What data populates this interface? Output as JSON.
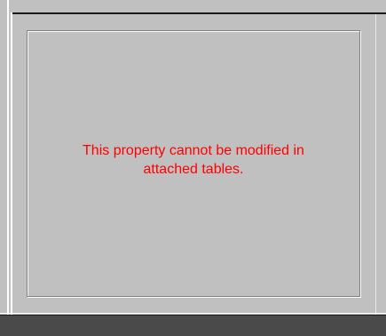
{
  "property_panel": {
    "message_line1": "This property cannot be modified in",
    "message_line2": "attached tables."
  },
  "colors": {
    "background": "#c0c0c0",
    "message_text": "#ff0000",
    "bottom_strip": "#4a4a4a"
  }
}
